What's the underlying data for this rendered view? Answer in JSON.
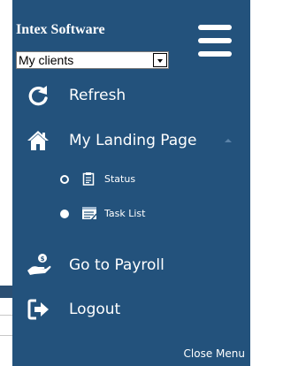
{
  "brand": "Intex Software",
  "client_select": {
    "value": "My clients"
  },
  "menu": {
    "refresh": "Refresh",
    "landing": "My Landing Page",
    "status": "Status",
    "task_list": "Task List",
    "payroll": "Go to Payroll",
    "logout": "Logout"
  },
  "close_menu": "Close Menu",
  "colors": {
    "panel_bg": "#23527c",
    "text": "#ffffff"
  },
  "icons": [
    "menu-icon",
    "refresh-icon",
    "home-icon",
    "clipboard-icon",
    "task-list-icon",
    "payroll-icon",
    "logout-icon"
  ]
}
